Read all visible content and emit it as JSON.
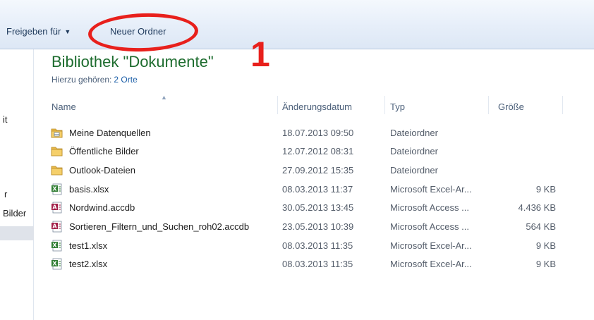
{
  "toolbar": {
    "share_label": "Freigeben für",
    "share_caret": "▼",
    "new_folder_label": "Neuer Ordner"
  },
  "annotation": {
    "number": "1",
    "color": "#e8201c"
  },
  "nav": {
    "items": [
      "it",
      "r",
      "Bilder"
    ]
  },
  "library": {
    "title": "Bibliothek \"Dokumente\"",
    "includes_label": "Hierzu gehören:",
    "includes_link": "2 Orte"
  },
  "columns": {
    "name": "Name",
    "date": "Änderungsdatum",
    "type": "Typ",
    "size": "Größe"
  },
  "files": [
    {
      "name": "Meine Datenquellen",
      "date": "18.07.2013 09:50",
      "type": "Dateiordner",
      "size": "",
      "icon": "folder-datasource-icon"
    },
    {
      "name": "Öffentliche Bilder",
      "date": "12.07.2012 08:31",
      "type": "Dateiordner",
      "size": "",
      "icon": "folder-icon"
    },
    {
      "name": "Outlook-Dateien",
      "date": "27.09.2012 15:35",
      "type": "Dateiordner",
      "size": "",
      "icon": "folder-icon"
    },
    {
      "name": "basis.xlsx",
      "date": "08.03.2013 11:37",
      "type": "Microsoft Excel-Ar...",
      "size": "9 KB",
      "icon": "excel-file-icon"
    },
    {
      "name": "Nordwind.accdb",
      "date": "30.05.2013 13:45",
      "type": "Microsoft Access ...",
      "size": "4.436 KB",
      "icon": "access-file-icon"
    },
    {
      "name": "Sortieren_Filtern_und_Suchen_roh02.accdb",
      "date": "23.05.2013 10:39",
      "type": "Microsoft Access ...",
      "size": "564 KB",
      "icon": "access-file-icon"
    },
    {
      "name": "test1.xlsx",
      "date": "08.03.2013 11:35",
      "type": "Microsoft Excel-Ar...",
      "size": "9 KB",
      "icon": "excel-file-icon"
    },
    {
      "name": "test2.xlsx",
      "date": "08.03.2013 11:35",
      "type": "Microsoft Excel-Ar...",
      "size": "9 KB",
      "icon": "excel-file-icon"
    }
  ],
  "colors": {
    "folder": "#e9b949",
    "excel": "#2f7d32",
    "access": "#a3204a",
    "library_title": "#1d6c2e",
    "link": "#1c5fa8"
  }
}
